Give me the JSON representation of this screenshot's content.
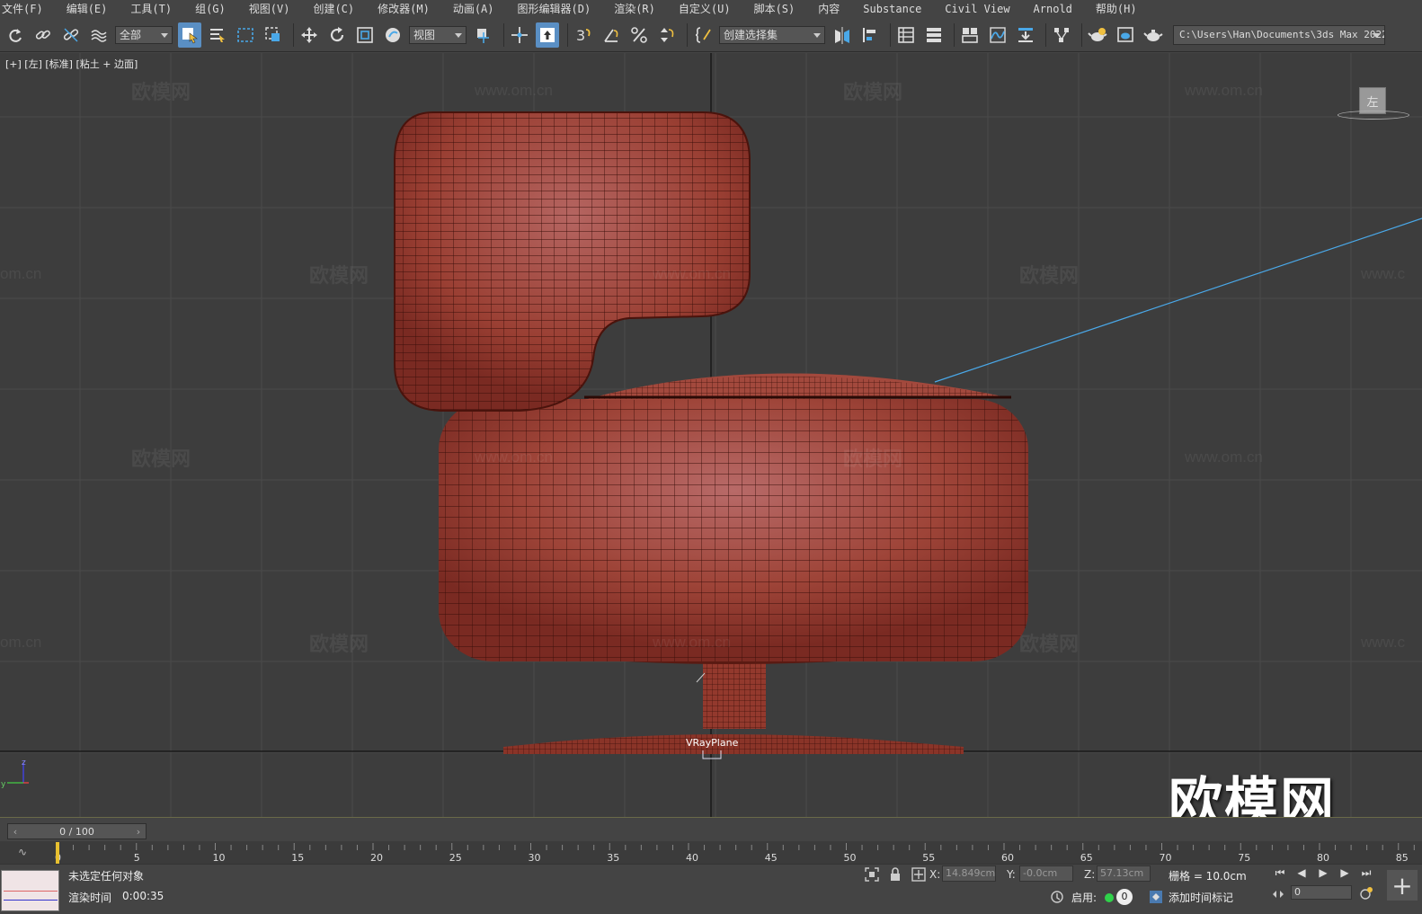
{
  "menu": [
    "文件(F)",
    "编辑(E)",
    "工具(T)",
    "组(G)",
    "视图(V)",
    "创建(C)",
    "修改器(M)",
    "动画(A)",
    "图形编辑器(D)",
    "渲染(R)",
    "自定义(U)",
    "脚本(S)",
    "内容",
    "Substance",
    "Civil View",
    "Arnold",
    "帮助(H)"
  ],
  "toolbar": {
    "filter": "全部",
    "refcoord": "视图",
    "selset": "创建选择集",
    "snap_num": "3",
    "path": "C:\\Users\\Han\\Documents\\3ds Max 2022"
  },
  "viewport": {
    "label": "[+] [左] [标准] [粘土 + 边面]",
    "object": "VRayPlane",
    "viewcube": "左",
    "brand": "欧模网",
    "wm_cn": "欧模网",
    "wm_url": "www.om.cn",
    "wm_url_cut": "om.cn",
    "wm_url_edge": "www.c",
    "axis_z": "z",
    "axis_y": "y"
  },
  "timeline": {
    "slider": "0 / 100",
    "ticks": [
      "0",
      "5",
      "10",
      "15",
      "20",
      "25",
      "30",
      "35",
      "40",
      "45",
      "50",
      "55",
      "60",
      "65",
      "70",
      "75",
      "80",
      "85"
    ]
  },
  "status": {
    "message": "未选定任何对象",
    "render_label": "渲染时间",
    "render_time": "0:00:35",
    "x_label": "X:",
    "x": "14.849cm",
    "y_label": "Y:",
    "y": "-0.0cm",
    "z_label": "Z:",
    "z": "57.13cm",
    "grid": "栅格 = 10.0cm",
    "enable": "启用:",
    "enable_count": "0",
    "add_time_tag": "添加时间标记",
    "frame": "0"
  },
  "colors": {
    "mesh": "#a0443a",
    "accent": "#5a8fc4",
    "light_line": "#4aa8e8"
  }
}
